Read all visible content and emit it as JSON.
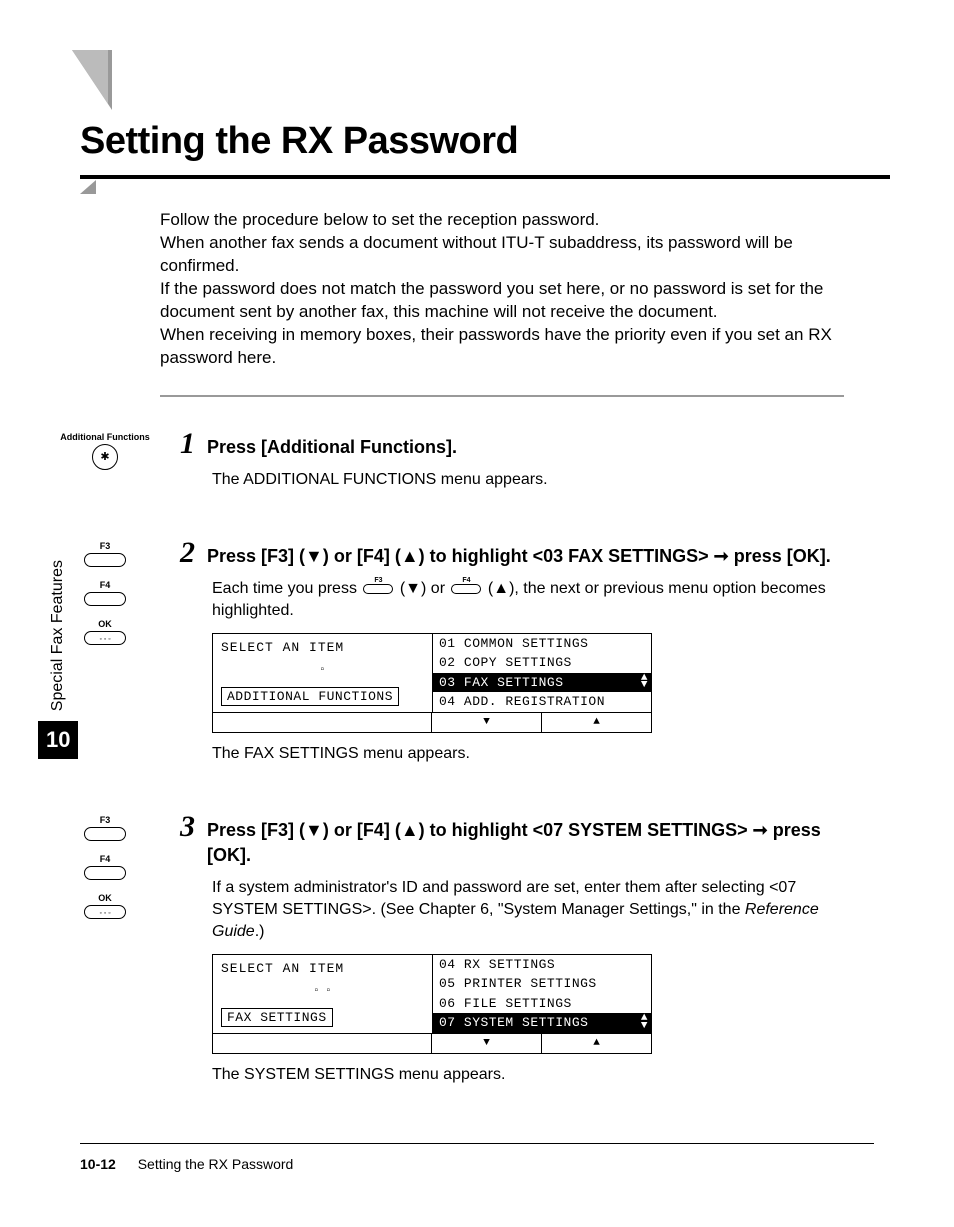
{
  "title": "Setting the RX Password",
  "intro": "Follow the procedure below to set the reception password.\nWhen another fax sends a document without ITU-T subaddress, its password will be confirmed.\nIf the password does not match the password you set here, or no password is set for the document sent by another fax, this machine will not receive the document.\nWhen receiving in memory boxes, their passwords have the priority even if you set an RX password here.",
  "side_tab": {
    "label": "Special Fax Features",
    "chapter": "10"
  },
  "steps": [
    {
      "num": "1",
      "icon_set": "addfunc",
      "title": "Press [Additional Functions].",
      "after": "The ADDITIONAL FUNCTIONS menu appears."
    },
    {
      "num": "2",
      "icon_set": "f3f4ok",
      "title": "Press [F3] (▼) or [F4] (▲) to highlight <03 FAX SETTINGS> ➞ press [OK].",
      "before": "Each time you press ",
      "before2": " (▼) or ",
      "before3": " (▲), the next or previous menu option becomes highlighted.",
      "lcd": {
        "left_title": "SELECT AN ITEM",
        "left_squares": "▫",
        "left_bottom": "ADDITIONAL FUNCTIONS",
        "rows": [
          {
            "t": "01 COMMON SETTINGS",
            "hl": false
          },
          {
            "t": "02 COPY SETTINGS",
            "hl": false
          },
          {
            "t": "03 FAX SETTINGS",
            "hl": true
          },
          {
            "t": "04 ADD. REGISTRATION",
            "hl": false
          }
        ],
        "updown_at": 2
      },
      "after": "The FAX SETTINGS menu appears."
    },
    {
      "num": "3",
      "icon_set": "f3f4ok",
      "title": "Press [F3] (▼) or [F4] (▲) to highlight <07 SYSTEM SETTINGS> ➞ press [OK].",
      "text": "If a system administrator's ID and password are set, enter them after selecting <07 SYSTEM SETTINGS>. (See Chapter 6, \"System Manager Settings,\" in the ",
      "text_italic": "Reference Guide",
      "text_end": ".)",
      "lcd": {
        "left_title": "SELECT AN ITEM",
        "left_squares": "▫▫",
        "left_bottom": "FAX SETTINGS",
        "rows": [
          {
            "t": "04 RX SETTINGS",
            "hl": false
          },
          {
            "t": "05 PRINTER SETTINGS",
            "hl": false
          },
          {
            "t": "06 FILE SETTINGS",
            "hl": false
          },
          {
            "t": "07 SYSTEM SETTINGS",
            "hl": true
          }
        ],
        "updown_at": 3
      },
      "after": "The SYSTEM SETTINGS menu appears."
    }
  ],
  "footer": {
    "page": "10-12",
    "title": "Setting the RX Password"
  },
  "key_labels": {
    "af": "Additional Functions",
    "f3": "F3",
    "f4": "F4",
    "ok": "OK"
  }
}
